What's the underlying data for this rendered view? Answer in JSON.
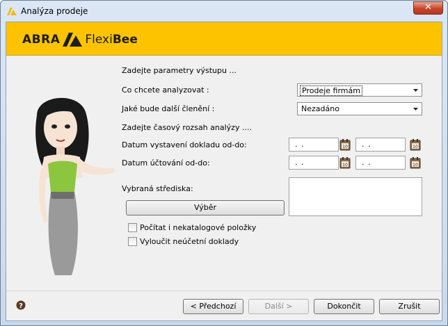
{
  "window": {
    "title": "Analýza prodeje",
    "close_symbol": "✕"
  },
  "banner": {
    "logo_abra": "ABRA",
    "logo_flexi": "Flexi",
    "logo_bee": "Bee",
    "color": "#fdc300"
  },
  "form": {
    "heading": "Zadejte parametry výstupu ...",
    "analyze_label": "Co chcete analyzovat :",
    "analyze_value": "Prodeje firmám",
    "split_label": "Jaké bude další členění :",
    "split_value": "Nezadáno",
    "range_heading": "Zadejte časový rozsah analýzy ....",
    "issue_date_label": "Datum vystavení dokladu od-do:",
    "issue_date_from": ". .",
    "issue_date_to": ". .",
    "account_date_label": "Datum účtování od-do:",
    "account_date_from": ". .",
    "account_date_to": ". .",
    "centers_label": "Vybraná střediska:",
    "select_button": "Výběr",
    "checkbox_nonstock": "Počítat i nekatalogové položky",
    "checkbox_exclude": "Vyloučit neúčetní doklady"
  },
  "footer": {
    "prev": "< Předchozí",
    "next": "Další >",
    "finish": "Dokončit",
    "cancel": "Zrušit"
  }
}
